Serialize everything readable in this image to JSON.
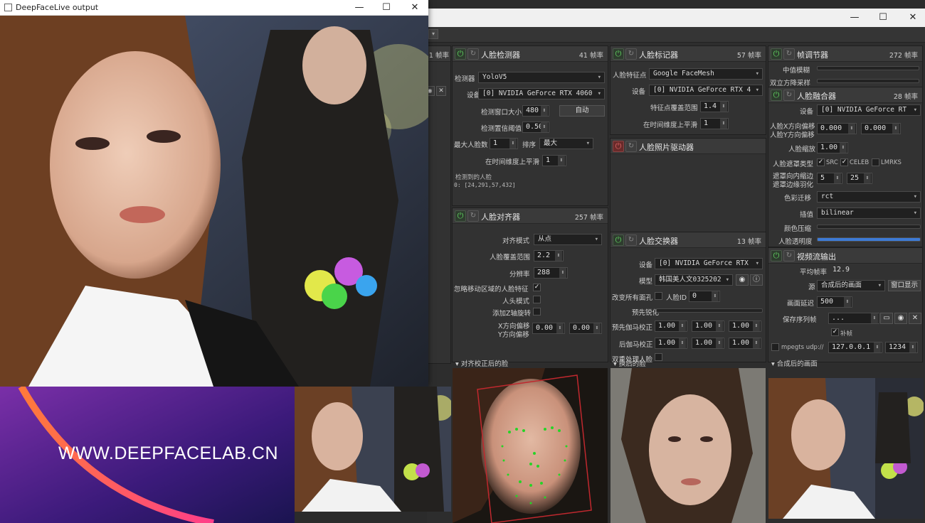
{
  "output_window": {
    "title": "DeepFaceLive output"
  },
  "banner": {
    "text": "WWW.DEEPFACELAB.CN"
  },
  "window_controls": {
    "minimize": "—",
    "maximize": "☐",
    "close": "✕"
  },
  "partial_panel": {
    "fps": "1 帧率"
  },
  "face_detector": {
    "title": "人脸检测器",
    "fps": "41 帧率",
    "detector_label": "检测器",
    "detector_value": "YoloV5",
    "device_label": "设备",
    "device_value": "[0] NVIDIA GeForce RTX 4060",
    "window_size_label": "检测窗口大小",
    "window_size_value": "480",
    "auto_button": "自动",
    "threshold_label": "检测置信阈值",
    "threshold_value": "0.50",
    "max_faces_label": "最大人脸数",
    "max_faces_value": "1",
    "sort_label": "排序",
    "sort_value": "最大",
    "temporal_label": "在时间维度上平滑",
    "temporal_value": "1",
    "detected_label": "检测到的人脸",
    "detected_value": "0: [24,291,57,432]"
  },
  "face_aligner": {
    "title": "人脸对齐器",
    "fps": "257 帧率",
    "mode_label": "对齐模式",
    "mode_value": "从点",
    "coverage_label": "人脸覆盖范围",
    "coverage_value": "2.2",
    "resolution_label": "分辨率",
    "resolution_value": "288",
    "exclude_moving_label": "忽略移动区域的人脸特征",
    "exclude_moving_checked": "✓",
    "head_mode_label": "人头模式",
    "z_rotation_label": "添加Z轴旋转",
    "x_offset_label": "X方向偏移",
    "y_offset_label": "Y方向偏移",
    "x_offset_value": "0.00",
    "y_offset_value": "0.00"
  },
  "face_marker": {
    "title": "人脸标记器",
    "fps": "57 帧率",
    "marker_label": "人脸特征点",
    "marker_value": "Google FaceMesh",
    "device_label": "设备",
    "device_value": "[0] NVIDIA GeForce RTX 4",
    "coverage_label": "特征点覆盖范围",
    "coverage_value": "1.4",
    "temporal_label": "在时间维度上平滑",
    "temporal_value": "1"
  },
  "face_animator": {
    "title": "人脸照片驱动器"
  },
  "face_swapper": {
    "title": "人脸交换器",
    "fps": "13 帧率",
    "device_label": "设备",
    "device_value": "[0] NVIDIA GeForce RTX",
    "model_label": "模型",
    "model_value": "韩国美人文0325202",
    "swap_all_label": "改变所有面孔",
    "face_id_label": "人脸ID",
    "face_id_value": "0",
    "presharpen_label": "预先锐化",
    "pre_gamma_label": "预先伽马校正",
    "post_gamma_label": "后伽马校正",
    "gamma_values": [
      "1.00",
      "1.00",
      "1.00"
    ],
    "post_gamma_values": [
      "1.00",
      "1.00",
      "1.00"
    ],
    "two_pass_label": "双重处理人脸"
  },
  "frame_adjuster": {
    "title": "帧调节器",
    "fps": "272 帧率",
    "median_label": "中值模糊",
    "bilateral_label": "双立方降采样"
  },
  "face_merger": {
    "title": "人脸融合器",
    "fps": "28 帧率",
    "device_label": "设备",
    "device_value": "[0] NVIDIA GeForce RT",
    "x_offset_label": "人脸X方向偏移",
    "y_offset_label": "人脸Y方向偏移",
    "x_offset_value": "0.000",
    "y_offset_value": "0.000",
    "scale_label": "人脸缩放",
    "scale_value": "1.00",
    "mask_type_label": "人脸遮罩类型",
    "mask_src": "SRC",
    "mask_celeb": "CELEB",
    "mask_lmrks": "LMRKS",
    "erode_label": "遮罩向内缩边",
    "blur_label": "遮罩边缘羽化",
    "erode_value": "5",
    "blur_value": "25",
    "color_transfer_label": "色彩迁移",
    "color_transfer_value": "rct",
    "interp_label": "插值",
    "interp_value": "bilinear",
    "color_compress_label": "颜色压缩",
    "opacity_label": "人脸透明度"
  },
  "stream_output": {
    "title": "视频流输出",
    "avg_fps_label": "平均帧率",
    "avg_fps_value": "12.9",
    "source_label": "源",
    "source_value": "合成后的画面",
    "window_button": "窗口显示",
    "delay_label": "画面延迟",
    "delay_value": "500",
    "save_seq_label": "保存序列帧",
    "save_seq_value": "...",
    "fill_frames_label": "补帧",
    "mpegts_label": "mpegts udp://",
    "mpegts_host": "127.0.0.1",
    "mpegts_port": "1234"
  },
  "views": {
    "aligned": "▾ 对齐校正后的脸",
    "swapped": "▾ 换后的脸",
    "merged": "▾ 合成后的画面"
  }
}
